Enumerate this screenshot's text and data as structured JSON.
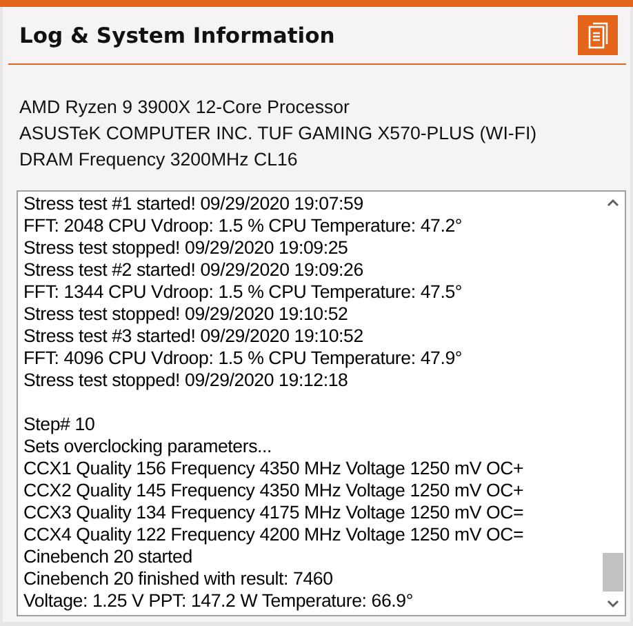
{
  "panel": {
    "title": "Log & System Information"
  },
  "system_info": [
    "AMD Ryzen 9 3900X 12-Core Processor",
    "ASUSTeK COMPUTER INC. TUF GAMING X570-PLUS (WI-FI)",
    "DRAM Frequency 3200MHz CL16"
  ],
  "log": {
    "groups": [
      {
        "lines": [
          "Stress test #1 started!  09/29/2020 19:07:59",
          "FFT: 2048  CPU Vdroop: 1.5 %  CPU Temperature: 47.2°",
          "Stress test stopped!  09/29/2020 19:09:25",
          "Stress test #2 started!  09/29/2020 19:09:26",
          "FFT: 1344  CPU Vdroop: 1.5 %  CPU Temperature: 47.5°",
          "Stress test stopped!  09/29/2020 19:10:52",
          "Stress test #3 started!  09/29/2020 19:10:52",
          "FFT: 4096  CPU Vdroop: 1.5 %  CPU Temperature: 47.9°",
          "Stress test stopped!  09/29/2020 19:12:18"
        ]
      },
      {
        "lines": [
          "Step# 10",
          "Sets overclocking parameters...",
          "CCX1  Quality 156  Frequency 4350 MHz  Voltage 1250 mV  OC+",
          "CCX2  Quality 145  Frequency 4350 MHz  Voltage 1250 mV  OC+",
          "CCX3  Quality 134  Frequency 4175 MHz  Voltage 1250 mV  OC=",
          "CCX4  Quality 122  Frequency 4200 MHz  Voltage 1250 mV  OC=",
          "Cinebench 20 started",
          "Cinebench 20 finished with result: 7460",
          "Voltage: 1.25 V  PPT: 147.2 W  Temperature: 66.9°"
        ]
      }
    ]
  }
}
